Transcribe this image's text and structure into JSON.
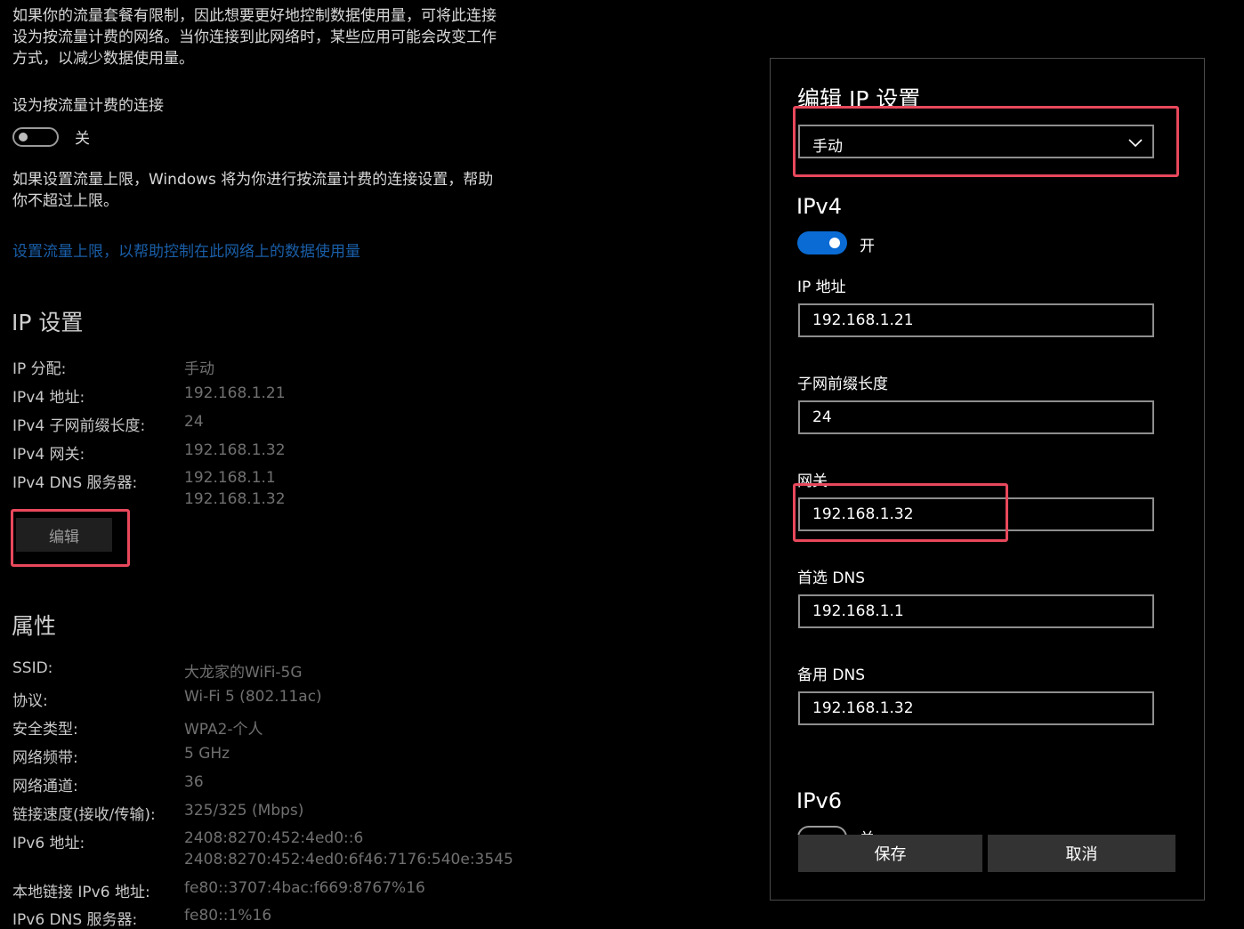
{
  "left": {
    "metered_desc": [
      "如果你的流量套餐有限制，因此想要更好地控制数据使用量，可将此连接",
      "设为按流量计费的网络。当你连接到此网络时，某些应用可能会改变工作",
      "方式，以减少数据使用量。"
    ],
    "metered_toggle_label": "设为按流量计费的连接",
    "metered_toggle_state": "关",
    "limit_desc": [
      "如果设置流量上限，Windows 将为你进行按流量计费的连接设置，帮助",
      "你不超过上限。"
    ],
    "limit_link": "设置流量上限，以帮助控制在此网络上的数据使用量",
    "ip_heading": "IP 设置",
    "ip_rows": [
      {
        "label": "IP 分配:",
        "value": "手动"
      },
      {
        "label": "IPv4 地址:",
        "value": "192.168.1.21"
      },
      {
        "label": "IPv4 子网前缀长度:",
        "value": "24"
      },
      {
        "label": "IPv4 网关:",
        "value": "192.168.1.32"
      },
      {
        "label": "IPv4 DNS 服务器:",
        "value": "192.168.1.1",
        "value2": "192.168.1.32"
      }
    ],
    "edit_button": "编辑",
    "props_heading": "属性",
    "props_rows": [
      {
        "label": "SSID:",
        "value": "大龙家的WiFi-5G"
      },
      {
        "label": "协议:",
        "value": "Wi-Fi 5 (802.11ac)"
      },
      {
        "label": "安全类型:",
        "value": "WPA2-个人"
      },
      {
        "label": "网络频带:",
        "value": "5 GHz"
      },
      {
        "label": "网络通道:",
        "value": "36"
      },
      {
        "label": "链接速度(接收/传输):",
        "value": "325/325 (Mbps)"
      },
      {
        "label": "IPv6 地址:",
        "value": "2408:8270:452:4ed0::6",
        "value2": "2408:8270:452:4ed0:6f46:7176:540e:3545"
      },
      {
        "label": "本地链接 IPv6 地址:",
        "value": "fe80::3707:4bac:f669:8767%16"
      },
      {
        "label": "IPv6 DNS 服务器:",
        "value": "fe80::1%16"
      }
    ]
  },
  "dialog": {
    "title": "编辑 IP 设置",
    "mode_select": "手动",
    "ipv4_heading": "IPv4",
    "ipv4_toggle_state": "开",
    "fields": {
      "ip_label": "IP 地址",
      "ip_value": "192.168.1.21",
      "prefix_label": "子网前缀长度",
      "prefix_value": "24",
      "gateway_label": "网关",
      "gateway_value": "192.168.1.32",
      "dns1_label": "首选 DNS",
      "dns1_value": "192.168.1.1",
      "dns2_label": "备用 DNS",
      "dns2_value": "192.168.1.32"
    },
    "ipv6_heading": "IPv6",
    "ipv6_toggle_state": "关",
    "save_button": "保存",
    "cancel_button": "取消"
  },
  "colors": {
    "highlight": "#e8485c",
    "toggle_on": "#0a6bd4",
    "link": "#1a5ea8"
  }
}
